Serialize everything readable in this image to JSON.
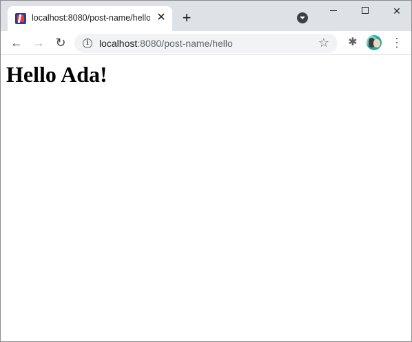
{
  "browser": {
    "tab": {
      "title": "localhost:8080/post-name/hello",
      "close_glyph": "✕"
    },
    "new_tab_glyph": "+",
    "window_controls": {
      "close_glyph": "✕"
    },
    "toolbar": {
      "back_glyph": "←",
      "forward_glyph": "→",
      "reload_glyph": "↻",
      "url_host": "localhost",
      "url_rest": ":8080/post-name/hello",
      "info_glyph": "i",
      "star_glyph": "☆",
      "extensions_glyph": "✱",
      "menu_glyph": "⋮"
    },
    "icons": {
      "favicon": "app-favicon-icon",
      "tab_search": "tab-search-icon",
      "info": "info-icon",
      "bookmark": "star-icon",
      "extensions": "puzzle-icon",
      "profile": "avatar",
      "menu": "kebab-menu-icon"
    }
  },
  "page": {
    "heading": "Hello Ada!"
  }
}
